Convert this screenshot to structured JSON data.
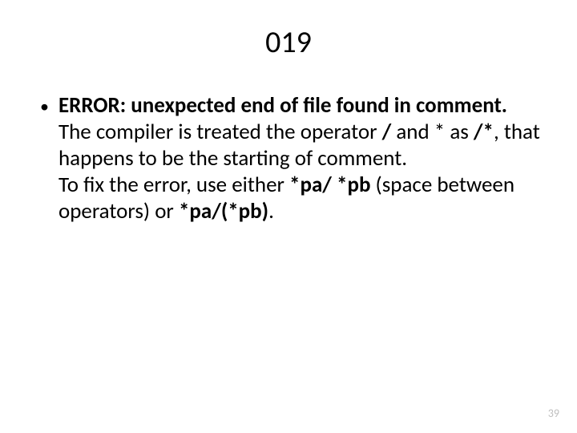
{
  "title": "019",
  "bullet": "•",
  "body": {
    "seg0": "ERROR: unexpected end of file found in comment.",
    "seg1": "The compiler is treated the operator ",
    "seg2": "/",
    "seg3": " and * as ",
    "seg4": "/*",
    "seg5": ", that happens to be the starting of comment.",
    "seg6": "To fix the error, use either ",
    "seg7": "*pa/ *pb",
    "seg8": " (space between operators) or ",
    "seg9": "*pa/(*pb)",
    "seg10": "."
  },
  "pageNumber": "39"
}
